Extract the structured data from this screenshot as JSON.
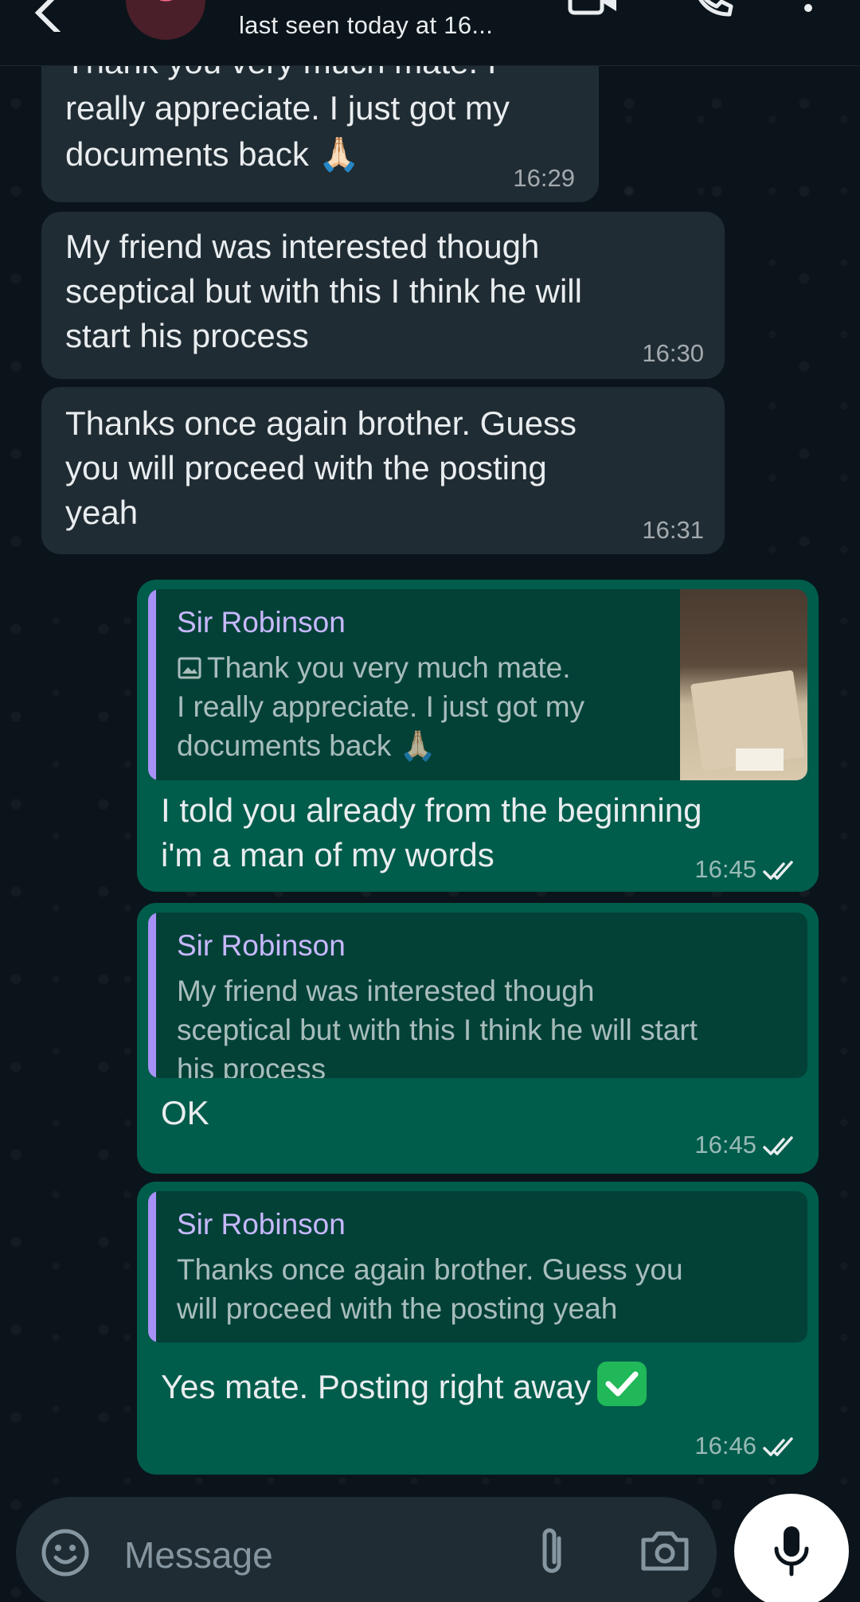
{
  "header": {
    "avatar_letter": "S",
    "status": "last seen today at 16..."
  },
  "messages": [
    {
      "type": "incoming",
      "lines": [
        "Thank you very much mate. I",
        "really appreciate. I just got my",
        "documents back 🙏🏻"
      ],
      "time": "16:29"
    },
    {
      "type": "incoming",
      "lines": [
        "My friend was interested though",
        "sceptical but with this I think he will",
        "start his process"
      ],
      "time": "16:30"
    },
    {
      "type": "incoming",
      "lines": [
        "Thanks once again brother. Guess",
        "you will proceed with the posting",
        "yeah"
      ],
      "time": "16:31"
    },
    {
      "type": "outgoing",
      "quote": {
        "name": "Sir Robinson",
        "lines": [
          "Thank you very much mate.",
          "I really appreciate. I just got my",
          "documents back 🙏🏻"
        ]
      },
      "lines": [
        "I told you already from the beginning",
        "i'm a man of my words"
      ],
      "time": "16:45"
    },
    {
      "type": "outgoing",
      "quote": {
        "name": "Sir Robinson",
        "lines": [
          "My friend was interested though",
          "sceptical but with this I think he will start",
          "his process"
        ]
      },
      "lines": [
        "OK"
      ],
      "time": "16:45"
    },
    {
      "type": "outgoing",
      "quote": {
        "name": "Sir Robinson",
        "lines": [
          "Thanks once again brother. Guess you",
          "will proceed with the posting yeah"
        ]
      },
      "lines": [
        "Yes mate. Posting right away"
      ],
      "time": "16:46"
    }
  ],
  "composer": {
    "placeholder": "Message"
  },
  "colors": {
    "background": "#0b141a",
    "incoming_bubble": "#202c33",
    "outgoing_bubble": "#005c4b",
    "quote_accent": "#a791f6",
    "read_ticks": "#e9edef"
  }
}
